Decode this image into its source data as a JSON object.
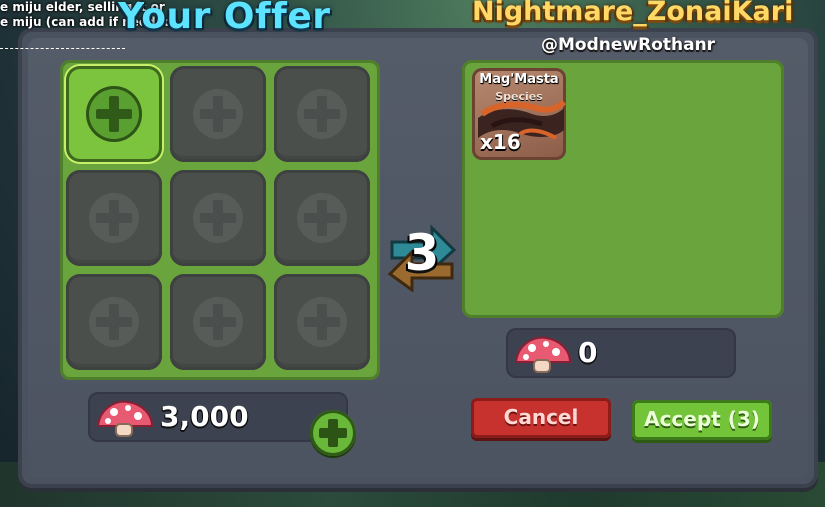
{
  "ticker": {
    "line1": "e miju elder, selling it or",
    "line2": "e miju (can add if needed)."
  },
  "your_offer": {
    "title": "Your Offer",
    "coins": "3,000",
    "slots": 9
  },
  "partner": {
    "display_name": "Nightmare_ZonaiKari",
    "username": "@ModnewRothanr",
    "coins": "0",
    "items": [
      {
        "name": "Mag'Masta",
        "type": "Species",
        "quantity": "x16"
      }
    ]
  },
  "swap": {
    "countdown": "3"
  },
  "buttons": {
    "cancel": "Cancel",
    "accept": "Accept (3)"
  },
  "colors": {
    "offer_title": "#5ce3ff",
    "partner_name": "#ffd866",
    "grid_green": "#6aa43c",
    "cancel_red": "#c8322e",
    "accept_green": "#74c43a",
    "panel": "#4a515f"
  }
}
